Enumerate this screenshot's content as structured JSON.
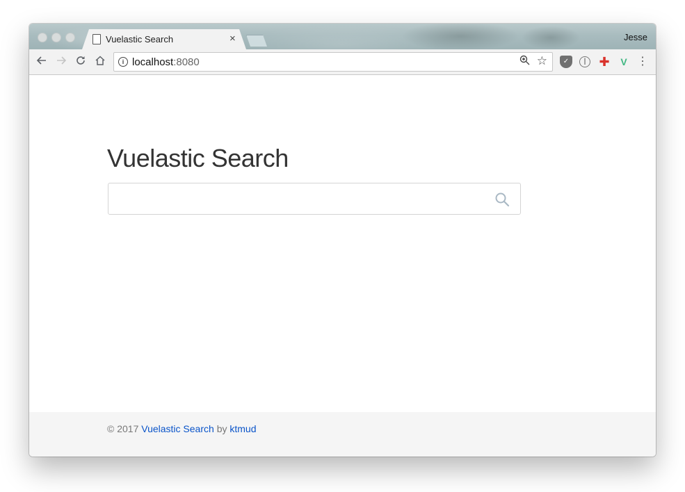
{
  "browser": {
    "tab_title": "Vuelastic Search",
    "tab_close": "×",
    "profile_name": "Jesse",
    "url_host": "localhost",
    "url_port": ":8080",
    "icons": {
      "back": "arrow-left",
      "forward": "arrow-right",
      "reload": "reload",
      "home": "home",
      "info": "info-circle",
      "zoom": "zoom-in",
      "bookmark": "star",
      "pocket": "pocket",
      "onepassword": "1password",
      "cross": "medical-cross",
      "vue_devtools": "vue",
      "menu": "vertical-dots"
    }
  },
  "page": {
    "title": "Vuelastic Search",
    "search": {
      "value": "",
      "placeholder": ""
    },
    "footer": {
      "copyright": "© 2017",
      "project_link": "Vuelastic Search",
      "by": "by",
      "author_link": "ktmud"
    }
  },
  "colors": {
    "link": "#0a54c9",
    "search_icon": "#a9b8c4",
    "vue_green": "#41b883"
  }
}
